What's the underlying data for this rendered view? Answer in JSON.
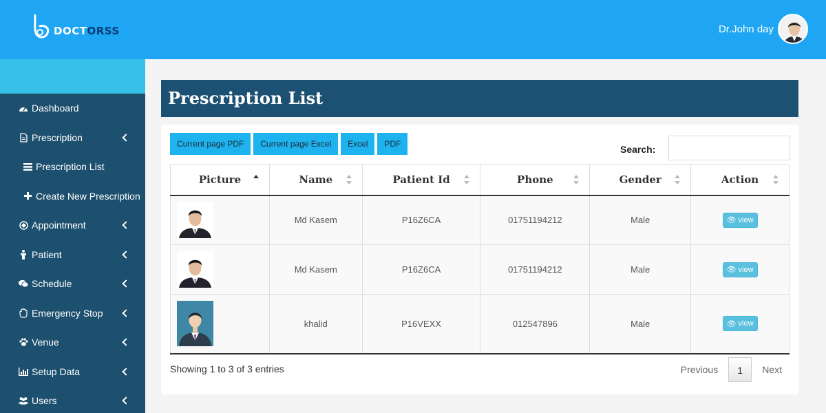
{
  "header": {
    "logo_part1": "DOCT",
    "logo_part2": "ORSS",
    "user_name": "Dr.John day"
  },
  "sidebar": {
    "items": [
      {
        "label": "Dashboard",
        "icon": "dashboard-icon"
      },
      {
        "label": "Prescription",
        "icon": "document-icon"
      },
      {
        "label": "Prescription List",
        "icon": "list-icon"
      },
      {
        "label": "Create New Prescription",
        "icon": "plus-icon"
      },
      {
        "label": "Appointment",
        "icon": "appointment-icon"
      },
      {
        "label": "Patient",
        "icon": "patient-icon"
      },
      {
        "label": "Schedule",
        "icon": "schedule-icon"
      },
      {
        "label": "Emergency Stop",
        "icon": "hand-stop-icon"
      },
      {
        "label": "Venue",
        "icon": "paw-icon"
      },
      {
        "label": "Setup Data",
        "icon": "bar-chart-icon"
      },
      {
        "label": "Users",
        "icon": "users-icon"
      }
    ]
  },
  "page": {
    "title": "Prescription List"
  },
  "toolbar": {
    "current_pdf": "Current page PDF",
    "current_excel": "Current page Excel",
    "excel": "Excel",
    "pdf": "PDF",
    "search_label": "Search:",
    "search_value": ""
  },
  "table": {
    "columns": [
      "Picture",
      "Name",
      "Patient Id",
      "Phone",
      "Gender",
      "Action"
    ],
    "rows": [
      {
        "name": "Md Kasem",
        "patient_id": "P16Z6CA",
        "phone": "01751194212",
        "gender": "Male",
        "action": "view"
      },
      {
        "name": "Md Kasem",
        "patient_id": "P16Z6CA",
        "phone": "01751194212",
        "gender": "Male",
        "action": "view"
      },
      {
        "name": "khalid",
        "patient_id": "P16VEXX",
        "phone": "012547896",
        "gender": "Male",
        "action": "view"
      }
    ]
  },
  "footer": {
    "info": "Showing 1 to 3 of 3 entries",
    "previous": "Previous",
    "page": "1",
    "next": "Next"
  },
  "colors": {
    "topbar": "#1ea6f4",
    "sidebar": "#1d4f6e",
    "sidebar_accent": "#36c0e8",
    "title_bar": "#1d5173",
    "button": "#1eb3ee",
    "view_button": "#5bc0de"
  }
}
